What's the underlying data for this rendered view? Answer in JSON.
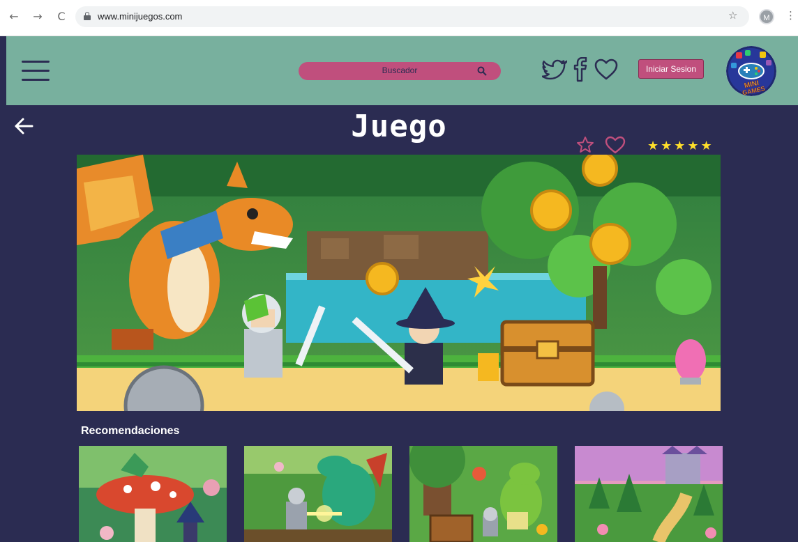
{
  "browser": {
    "url": "www.minijuegos.com",
    "profile_initial": "M",
    "back_glyph": "←",
    "forward_glyph": "→",
    "reload_glyph": "C",
    "bookmark_glyph": "☆",
    "menu_glyph": "⋮"
  },
  "header": {
    "search_placeholder": "Buscador",
    "login_label": "Iniciar Sesion",
    "logo_text": [
      "MINI",
      "GAMES"
    ],
    "colors": {
      "bar": "#78b09e",
      "accent": "#c04f7d",
      "page": "#2b2c52"
    }
  },
  "main": {
    "title": "Juego",
    "rating_stars": "★★★★★",
    "rating_value": 5,
    "recommendations_title": "Recomendaciones"
  },
  "icons": [
    "back-arrow-icon",
    "menu-icon",
    "search-icon",
    "twitter-icon",
    "facebook-icon",
    "heart-icon",
    "star-outline-icon",
    "heart-outline-icon"
  ]
}
